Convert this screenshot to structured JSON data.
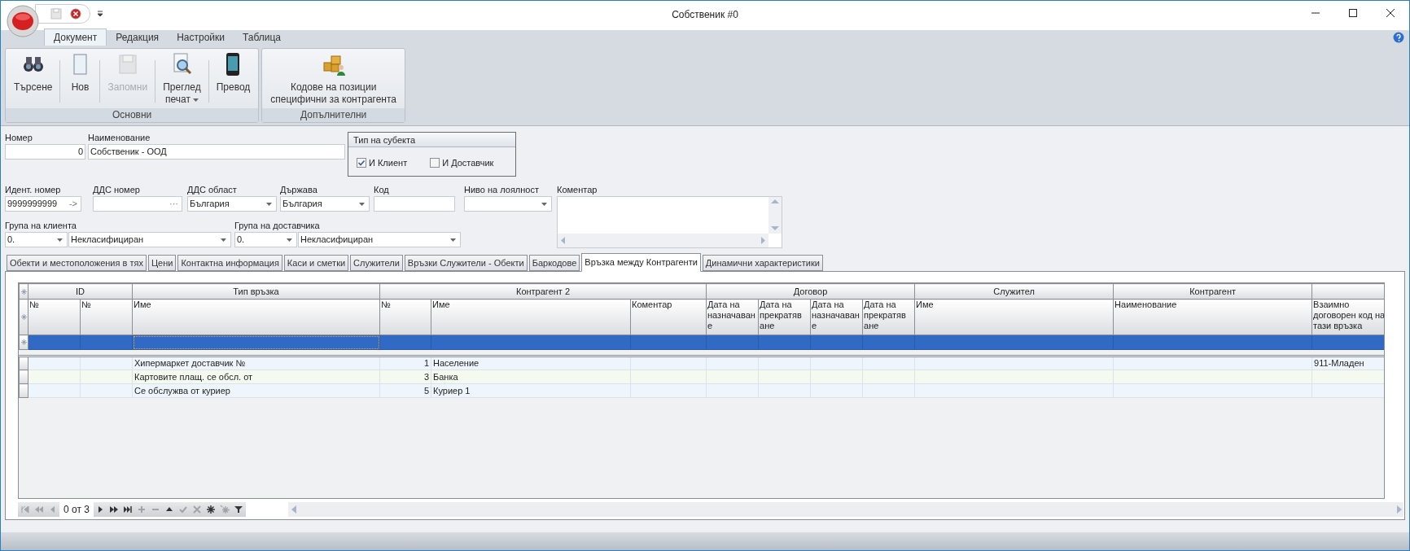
{
  "window": {
    "title": "Собственик #0"
  },
  "ribbon": {
    "tabs": [
      {
        "label": "Документ",
        "selected": true
      },
      {
        "label": "Редакция",
        "selected": false
      },
      {
        "label": "Настройки",
        "selected": false
      },
      {
        "label": "Таблица",
        "selected": false
      }
    ],
    "groups": [
      {
        "label": "Основни",
        "buttons": [
          {
            "kind": "search",
            "label": "Търсене",
            "disabled": false
          },
          {
            "kind": "new",
            "label": "Нов",
            "disabled": false
          },
          {
            "kind": "save",
            "label": "Запомни",
            "disabled": true
          },
          {
            "kind": "preview",
            "label": "Преглед\nпечат",
            "disabled": false,
            "dropdown": true
          },
          {
            "kind": "translate",
            "label": "Превод",
            "disabled": false
          }
        ]
      },
      {
        "label": "Допълнителни",
        "buttons": [
          {
            "kind": "codes",
            "label": "Кодове на позиции\nспецифични за контрагента",
            "disabled": false
          }
        ]
      }
    ]
  },
  "form": {
    "number": {
      "label": "Номер",
      "value": "0"
    },
    "name": {
      "label": "Наименование",
      "value": "Собственик - ООД"
    },
    "subject_type": {
      "title": "Тип на субекта",
      "options": [
        {
          "label": "И Клиент",
          "checked": true
        },
        {
          "label": "И Доставчик",
          "checked": false
        }
      ]
    },
    "id_number": {
      "label": "Идент. номер",
      "value": "9999999999",
      "action": "->"
    },
    "vat_number": {
      "label": "ДДС номер",
      "action": "···"
    },
    "vat_area": {
      "label": "ДДС област",
      "value": "България"
    },
    "country": {
      "label": "Държава",
      "value": "България"
    },
    "code": {
      "label": "Код"
    },
    "loyalty": {
      "label": "Ниво на лоялност"
    },
    "comment": {
      "label": "Коментар"
    },
    "client_group": {
      "label": "Група на клиента",
      "code": "0.",
      "value": "Некласифициран"
    },
    "supplier_group": {
      "label": "Група на доставчика",
      "code": "0.",
      "value": "Некласифициран"
    }
  },
  "tabs": [
    {
      "label": "Обекти и местоположения в тях",
      "selected": false
    },
    {
      "label": "Цени",
      "selected": false
    },
    {
      "label": "Контактна информация",
      "selected": false
    },
    {
      "label": "Каси и сметки",
      "selected": false
    },
    {
      "label": "Служители",
      "selected": false
    },
    {
      "label": "Връзки Служители - Обекти",
      "selected": false
    },
    {
      "label": "Баркодове",
      "selected": false
    },
    {
      "label": "Връзка между Контрагенти",
      "selected": true
    },
    {
      "label": "Динамични характеристики",
      "selected": false
    }
  ],
  "grid": {
    "column_groups": [
      "ID",
      "Тип връзка",
      "Контрагент 2",
      "Договор",
      "Служител",
      "Контрагент"
    ],
    "columns": [
      "№",
      "№",
      "Име",
      "№",
      "Име",
      "Коментар",
      "Дата на назначаван е",
      "Дата на прекратяв ане",
      "Дата на назначаван е",
      "Дата на прекратяв ане",
      "Име",
      "Наименование",
      "Взаимно договорен код на тази връзка"
    ],
    "new_row": {
      "selected": true
    },
    "rows": [
      {
        "cells": {
          "2": "Хипермаркет доставчик №",
          "3": "1",
          "4": "Население",
          "12": "911-Младен"
        }
      },
      {
        "cells": {
          "2": "Картовите плащ. се обсл. от",
          "3": "3",
          "4": "Банка"
        }
      },
      {
        "cells": {
          "2": "Се обслужва от куриер",
          "3": "5",
          "4": "Куриер 1"
        }
      }
    ]
  },
  "navigator": {
    "position": "0 от 3",
    "buttons": [
      {
        "kind": "first",
        "disabled": true
      },
      {
        "kind": "prev_page",
        "disabled": true
      },
      {
        "kind": "prev",
        "disabled": true
      },
      {
        "kind": "next",
        "disabled": false
      },
      {
        "kind": "next_page",
        "disabled": false
      },
      {
        "kind": "last",
        "disabled": false
      },
      {
        "kind": "add",
        "disabled": true
      },
      {
        "kind": "remove",
        "disabled": true
      },
      {
        "kind": "up",
        "disabled": false
      },
      {
        "kind": "accept",
        "disabled": true
      },
      {
        "kind": "cancel",
        "disabled": true
      },
      {
        "kind": "star",
        "disabled": false
      },
      {
        "kind": "star2",
        "disabled": true
      },
      {
        "kind": "filter",
        "disabled": false
      }
    ]
  }
}
